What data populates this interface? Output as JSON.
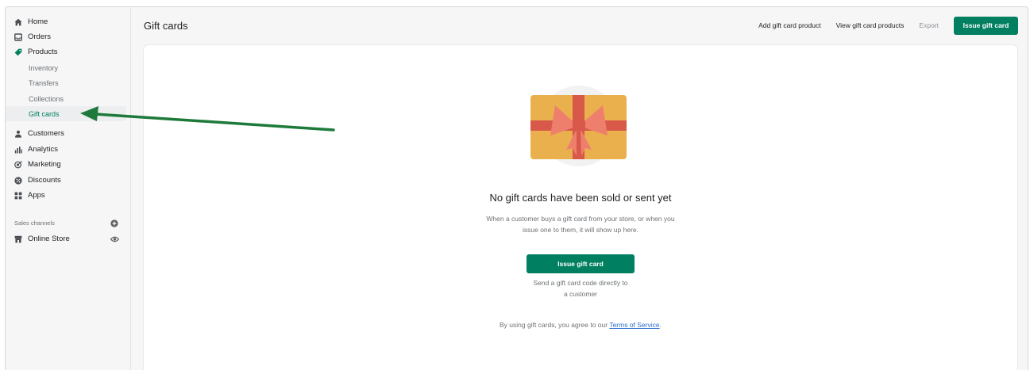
{
  "sidebar": {
    "items": [
      {
        "label": "Home",
        "icon": "home-icon"
      },
      {
        "label": "Orders",
        "icon": "orders-icon"
      },
      {
        "label": "Products",
        "icon": "tag-icon"
      }
    ],
    "product_subitems": [
      "Inventory",
      "Transfers",
      "Collections",
      "Gift cards"
    ],
    "items2": [
      {
        "label": "Customers",
        "icon": "person-icon"
      },
      {
        "label": "Analytics",
        "icon": "bar-chart-icon"
      },
      {
        "label": "Marketing",
        "icon": "target-icon"
      },
      {
        "label": "Discounts",
        "icon": "discount-icon"
      },
      {
        "label": "Apps",
        "icon": "apps-grid-icon"
      }
    ],
    "sales_channels_label": "Sales channels",
    "online_store_label": "Online Store"
  },
  "header": {
    "title": "Gift cards",
    "add_product": "Add gift card product",
    "view_products": "View gift card products",
    "export": "Export",
    "issue": "Issue gift card"
  },
  "empty_state": {
    "title": "No gift cards have been sold or sent yet",
    "desc_line1": "When a customer buys a gift card from your store, or when you",
    "desc_line2": "issue one to them, it will show up here.",
    "button": "Issue gift card",
    "help_line1": "Send a gift card code directly to",
    "help_line2": "a customer",
    "terms_prefix": "By using gift cards, you agree to our ",
    "terms_link": "Terms of Service",
    "terms_suffix": "."
  },
  "colors": {
    "primary": "#008060",
    "arrow": "#1e7a3a",
    "card_gold": "#e9b04d",
    "ribbon": "#d8584a",
    "link": "#2c6ecb"
  }
}
